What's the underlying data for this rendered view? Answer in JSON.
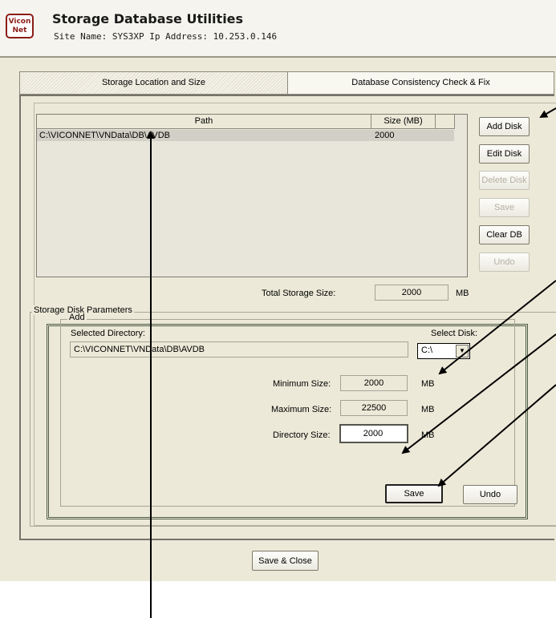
{
  "header": {
    "logo_text": "Vicon Net",
    "app_title": "Storage Database Utilities",
    "site_info": "Site Name: SYS3XP  Ip Address: 10.253.0.146"
  },
  "tabs": [
    {
      "label": "Storage Location and Size",
      "active": true
    },
    {
      "label": "Database Consistency Check & Fix",
      "active": false
    }
  ],
  "disk_list": {
    "columns": [
      "Path",
      "Size (MB)"
    ],
    "rows": [
      {
        "path": "C:\\VICONNET\\VNData\\DB\\AVDB",
        "size": "2000"
      }
    ]
  },
  "side_buttons": {
    "add_disk": "Add Disk",
    "edit_disk": "Edit Disk",
    "delete_disk": "Delete Disk",
    "save": "Save",
    "clear_db": "Clear DB",
    "undo": "Undo"
  },
  "total_storage": {
    "label": "Total Storage Size:",
    "value": "2000",
    "unit": "MB"
  },
  "storage_params": {
    "group_label": "Storage Disk Parameters",
    "add_group_label": "Add",
    "selected_directory_label": "Selected Directory:",
    "selected_directory_value": "C:\\VICONNET\\VNData\\DB\\AVDB",
    "select_disk_label": "Select Disk:",
    "select_disk_value": "C:\\",
    "min_size_label": "Minimum Size:",
    "min_size_value": "2000",
    "max_size_label": "Maximum Size:",
    "max_size_value": "22500",
    "dir_size_label": "Directory Size:",
    "dir_size_value": "2000",
    "unit": "MB",
    "save_button": "Save",
    "undo_button": "Undo"
  },
  "footer": {
    "save_close_button": "Save & Close"
  },
  "colors": {
    "window_bg": "#ece9d8",
    "logo_red": "#8b1d18",
    "selected_row": "#d2d0c6"
  }
}
